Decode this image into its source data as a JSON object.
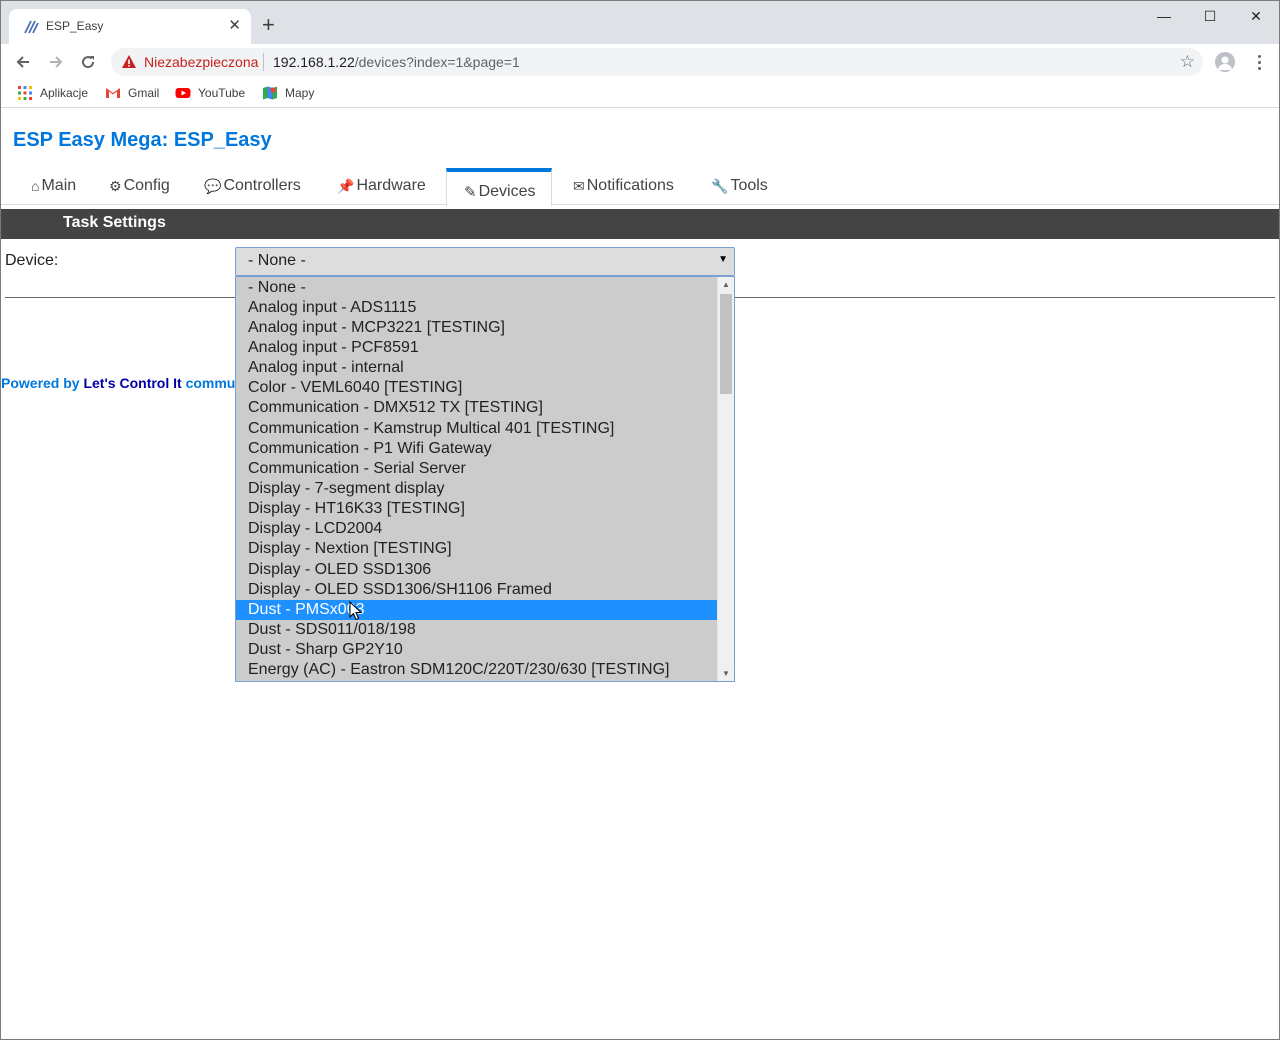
{
  "browser": {
    "tab_title": "ESP_Easy",
    "new_tab_symbol": "+",
    "close_tab_symbol": "✕",
    "window_controls": {
      "minimize": "—",
      "maximize": "☐",
      "close": "✕"
    },
    "security_label": "Niezabezpieczona",
    "url_host": "192.168.1.22",
    "url_path": "/devices?index=1&page=1",
    "bookmarks": [
      {
        "label": "Aplikacje",
        "icon": "apps-grid-icon"
      },
      {
        "label": "Gmail",
        "icon": "gmail-icon"
      },
      {
        "label": "YouTube",
        "icon": "youtube-icon"
      },
      {
        "label": "Mapy",
        "icon": "maps-icon"
      }
    ]
  },
  "page": {
    "title": "ESP Easy Mega: ESP_Easy",
    "menu": [
      {
        "label": "Main",
        "icon": "⌂"
      },
      {
        "label": "Config",
        "icon": "⚙"
      },
      {
        "label": "Controllers",
        "icon": "💬"
      },
      {
        "label": "Hardware",
        "icon": "📌"
      },
      {
        "label": "Devices",
        "icon": "✎",
        "active": true
      },
      {
        "label": "Notifications",
        "icon": "✉"
      },
      {
        "label": "Tools",
        "icon": "🔧"
      }
    ],
    "section_title": "Task Settings",
    "device_label": "Device:",
    "device_select": {
      "value": "- None -",
      "arrow": "▼",
      "options": [
        "- None -",
        "Analog input - ADS1115",
        "Analog input - MCP3221 [TESTING]",
        "Analog input - PCF8591",
        "Analog input - internal",
        "Color - VEML6040 [TESTING]",
        "Communication - DMX512 TX [TESTING]",
        "Communication - Kamstrup Multical 401 [TESTING]",
        "Communication - P1 Wifi Gateway",
        "Communication - Serial Server",
        "Display - 7-segment display",
        "Display - HT16K33 [TESTING]",
        "Display - LCD2004",
        "Display - Nextion [TESTING]",
        "Display - OLED SSD1306",
        "Display - OLED SSD1306/SH1106 Framed",
        "Dust - PMSx003",
        "Dust - SDS011/018/198",
        "Dust - Sharp GP2Y10",
        "Energy (AC) - Eastron SDM120C/220T/230/630 [TESTING]"
      ],
      "highlighted_index": 16
    },
    "footer": {
      "prefix": "Powered by ",
      "link": "Let's Control It",
      "suffix": " commu"
    }
  },
  "colors": {
    "accent": "#0077dd",
    "highlight": "#1e90ff",
    "section_bar": "#444444",
    "insecure": "#c5221f"
  }
}
